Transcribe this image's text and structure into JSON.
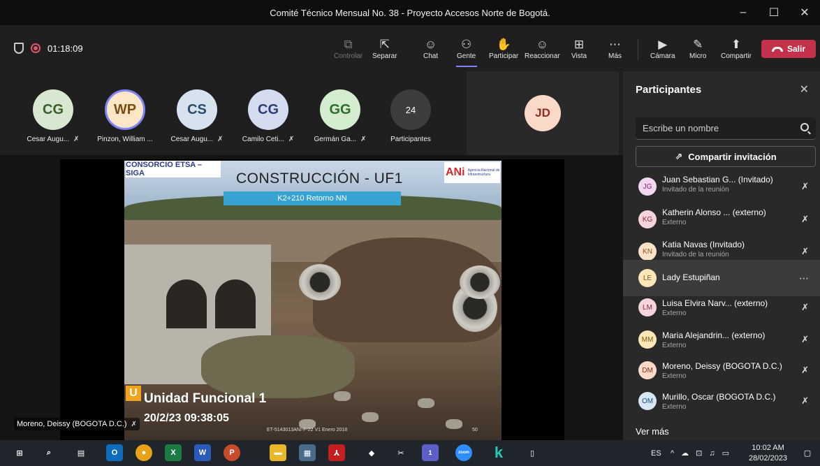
{
  "window": {
    "title": "Comité Técnico Mensual No. 38 - Proyecto Accesos Norte de Bogotá.",
    "controls": [
      "–",
      "☐",
      "✕"
    ]
  },
  "toolbar": {
    "timer": "01:18:09",
    "buttons": {
      "controlar": "Controlar",
      "separar": "Separar",
      "chat": "Chat",
      "gente": "Gente",
      "participar": "Participar",
      "reaccionar": "Reaccionar",
      "vista": "Vista",
      "mas": "Más",
      "camara": "Cámara",
      "micro": "Micro",
      "compartir": "Compartir"
    },
    "salir": "Salir",
    "accent": "#c4314b"
  },
  "tiles": [
    {
      "initials": "CG",
      "name": "Cesar Augu...",
      "bg": "#d8e8d0",
      "fg": "#3a5f2b"
    },
    {
      "initials": "WP",
      "name": "Pinzon, William ...",
      "bg": "#fbe6c8",
      "fg": "#7a4e16"
    },
    {
      "initials": "CS",
      "name": "Cesar Augu...",
      "bg": "#d6e3ef",
      "fg": "#2b4d6b"
    },
    {
      "initials": "CG",
      "name": "Camilo Ceti...",
      "bg": "#d5dcef",
      "fg": "#2e3f77"
    },
    {
      "initials": "GG",
      "name": "Germán Ga...",
      "bg": "#d4ecd0",
      "fg": "#2f6e2a"
    },
    {
      "initials": "24",
      "name": "Participantes",
      "bg": "#3d3d3d",
      "fg": "#ffffff"
    }
  ],
  "featured_tile": {
    "initials": "JD"
  },
  "slide": {
    "consorcio": "CONSORCIO ETSA – SIGA",
    "title": "CONSTRUCCIÓN - UF1",
    "subtitle": "K2+210 Retorno NN",
    "ani_mark": "ANi",
    "ani_text": "Agencia Nacional de Infraestructura",
    "uf_letter": "U",
    "uf_label": "Unidad Funcional 1",
    "datetime": "20/2/23 09:38:05",
    "code": "ET-5143013ANI-F-22 V1 Enero 2018",
    "page": "50"
  },
  "speaker_label": "Moreno, Deissy (BOGOTA D.C.)",
  "panel": {
    "title": "Participantes",
    "search_placeholder": "Escribe un nombre",
    "invite": "Compartir invitación",
    "participants": [
      {
        "initials": "JG",
        "name": "Juan Sebastian G... (Invitado)",
        "role": "Invitado de la reunión",
        "bg": "#f3d6ef",
        "fg": "#7a2a6e"
      },
      {
        "initials": "KG",
        "name": "Katherin Alonso ... (externo)",
        "role": "Externo",
        "bg": "#f6d4dc",
        "fg": "#8a2a40"
      },
      {
        "initials": "KN",
        "name": "Katia Navas (Invitado)",
        "role": "Invitado de la reunión",
        "bg": "#fbe3c8",
        "fg": "#8a5318"
      },
      {
        "initials": "LE",
        "name": "Lady Estupiñan",
        "role": "",
        "bg": "#fbe6b8",
        "fg": "#7a5a12"
      },
      {
        "initials": "LM",
        "name": "Luisa Elvira Narv... (externo)",
        "role": "Externo",
        "bg": "#f6d4dc",
        "fg": "#8a2a40"
      },
      {
        "initials": "MM",
        "name": "Maria Alejandrin... (externo)",
        "role": "Externo",
        "bg": "#fbe6b8",
        "fg": "#7a5a12"
      },
      {
        "initials": "DM",
        "name": "Moreno, Deissy (BOGOTA D.C.)",
        "role": "Externo",
        "bg": "#fbd9c8",
        "fg": "#8a2f22"
      },
      {
        "initials": "OM",
        "name": "Murillo, Oscar (BOGOTA D.C.)",
        "role": "Externo",
        "bg": "#d6e6f5",
        "fg": "#1f4e7a"
      }
    ],
    "ver_mas": "Ver más"
  },
  "taskbar": {
    "lang": "ES",
    "time": "10:02 AM",
    "date": "28/02/2023",
    "teams_badge": "1",
    "zoom_label": "zoom"
  }
}
